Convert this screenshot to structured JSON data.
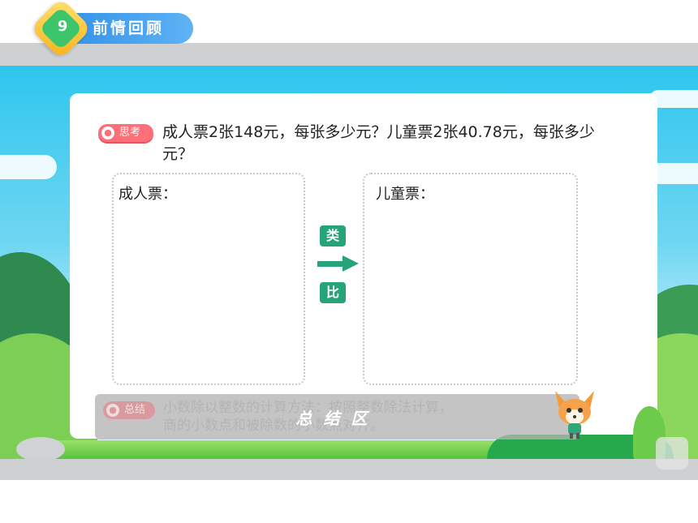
{
  "header": {
    "title": "前情回顾"
  },
  "question": {
    "badge": "思考",
    "text": "成人票2张148元，每张多少元？儿童票2张40.78元，每张多少元？"
  },
  "left_box": {
    "label": "成人票："
  },
  "right_box": {
    "label": "儿童票："
  },
  "compare": {
    "top": "类",
    "bottom": "比"
  },
  "summary": {
    "badge": "总结",
    "line1": "小数除以整数的计算方法：按照整数除法计算，",
    "line2": "商的小数点和被除数的小数点对齐。",
    "overlay_title": "总结区"
  },
  "colors": {
    "accent_green": "#27a37a",
    "title_blue": "#2f8ee8",
    "badge_red": "#ff6f78"
  }
}
